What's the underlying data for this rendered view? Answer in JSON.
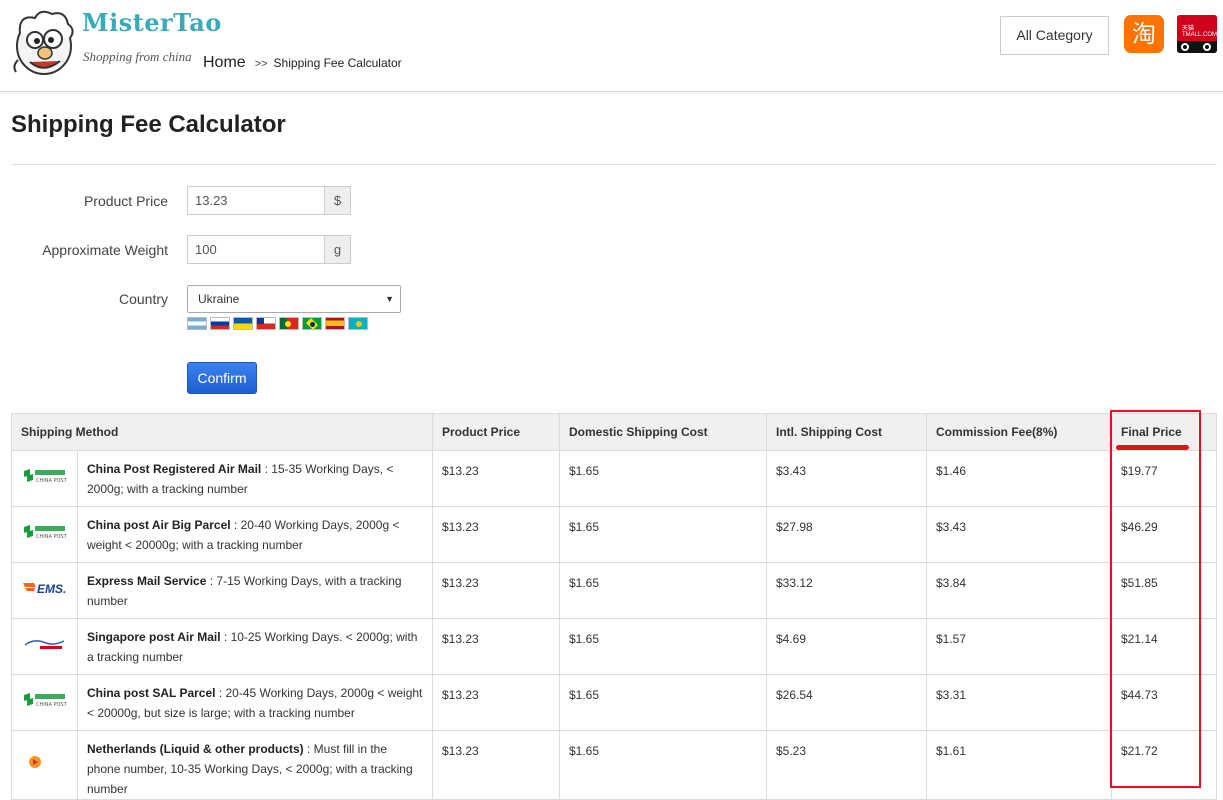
{
  "header": {
    "logo_title": "MisterTao",
    "logo_subtitle": "Shopping from china",
    "breadcrumb": {
      "home": "Home",
      "separator": ">>",
      "current": "Shipping Fee Calculator"
    },
    "all_category_label": "All Category",
    "taobao_glyph": "淘",
    "tmall_text": "天猫 TMALL.COM"
  },
  "page_title": "Shipping Fee Calculator",
  "form": {
    "product_price": {
      "label": "Product Price",
      "value": "13.23",
      "unit": "$"
    },
    "weight": {
      "label": "Approximate Weight",
      "value": "100",
      "unit": "g"
    },
    "country": {
      "label": "Country",
      "selected": "Ukraine"
    },
    "flags": [
      "argentina-flag",
      "russia-flag",
      "ukraine-flag",
      "chile-flag",
      "portugal-flag",
      "brazil-flag",
      "spain-flag",
      "kazakhstan-flag"
    ],
    "confirm_label": "Confirm"
  },
  "table": {
    "headers": [
      "Shipping Method",
      "Product Price",
      "Domestic Shipping Cost",
      "Intl. Shipping Cost",
      "Commission Fee(8%)",
      "Final Price"
    ],
    "rows": [
      {
        "logo": "china-post-logo",
        "name": "China Post Registered Air Mail",
        "detail": " : 15-35 Working Days, < 2000g; with a tracking number",
        "product_price": "$13.23",
        "domestic": "$1.65",
        "intl": "$3.43",
        "commission": "$1.46",
        "final": "$19.77"
      },
      {
        "logo": "china-post-logo",
        "name": "China post Air Big Parcel",
        "detail": " : 20-40 Working Days, 2000g < weight < 20000g; with a tracking number",
        "product_price": "$13.23",
        "domestic": "$1.65",
        "intl": "$27.98",
        "commission": "$3.43",
        "final": "$46.29"
      },
      {
        "logo": "ems-logo",
        "name": "Express Mail Service",
        "detail": " : 7-15 Working Days, with a tracking number",
        "product_price": "$13.23",
        "domestic": "$1.65",
        "intl": "$33.12",
        "commission": "$3.84",
        "final": "$51.85"
      },
      {
        "logo": "singapore-post-logo",
        "name": "Singapore post Air Mail",
        "detail": " : 10-25 Working Days. < 2000g; with a tracking number",
        "product_price": "$13.23",
        "domestic": "$1.65",
        "intl": "$4.69",
        "commission": "$1.57",
        "final": "$21.14"
      },
      {
        "logo": "china-post-logo",
        "name": "China post SAL Parcel",
        "detail": " : 20-45 Working Days, 2000g < weight < 20000g, but size is large; with a tracking number",
        "product_price": "$13.23",
        "domestic": "$1.65",
        "intl": "$26.54",
        "commission": "$3.31",
        "final": "$44.73"
      },
      {
        "logo": "postnl-logo",
        "name": "Netherlands (Liquid & other products)",
        "detail": " : Must fill in the phone number, 10-35 Working Days, < 2000g; with a tracking number",
        "product_price": "$13.23",
        "domestic": "$1.65",
        "intl": "$5.23",
        "commission": "$1.61",
        "final": "$21.72"
      }
    ]
  },
  "colors": {
    "accent_blue": "#2a6fe0",
    "highlight_red": "#e8101a",
    "logo_teal": "#3aa9b8",
    "taobao_orange": "#ff7300",
    "tmall_red": "#d0021b"
  }
}
